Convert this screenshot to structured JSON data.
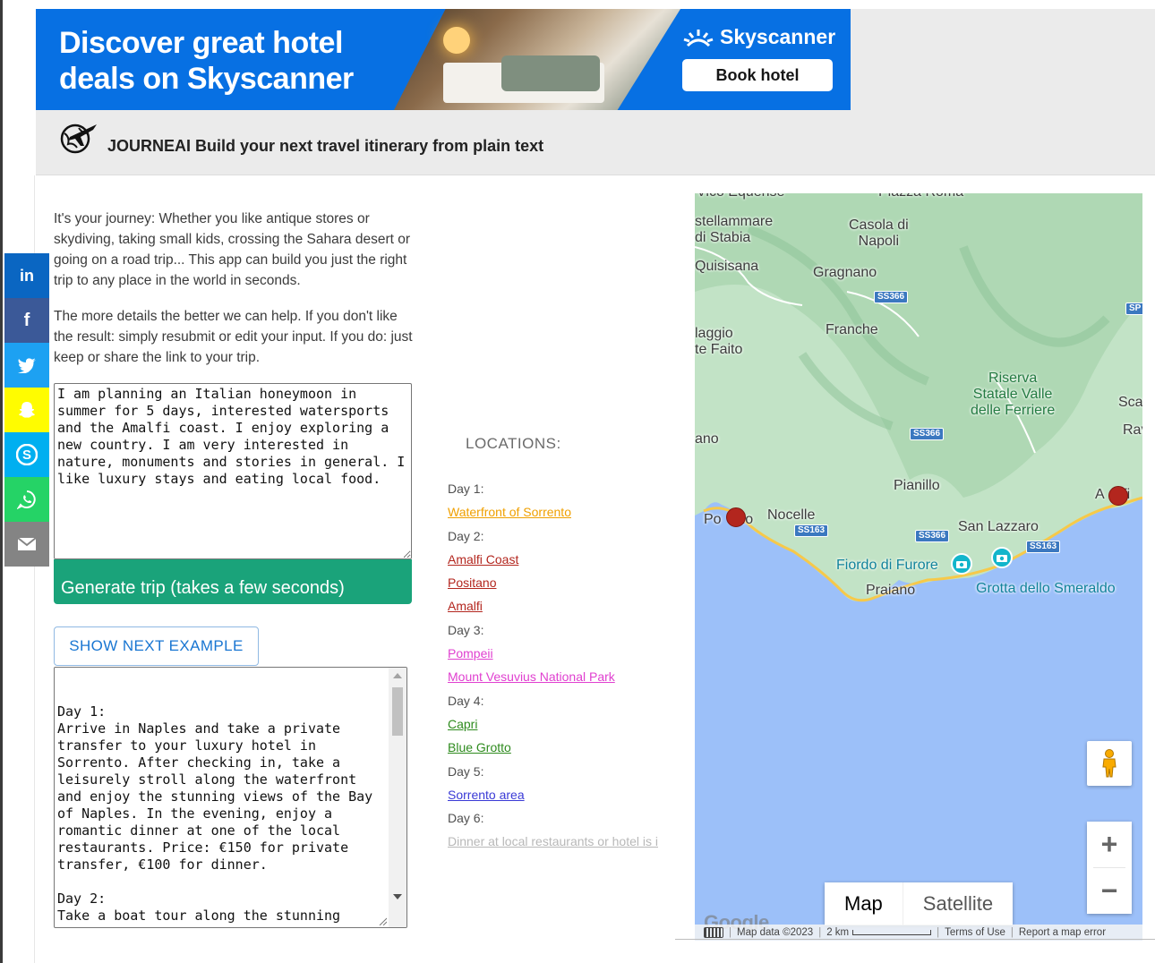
{
  "ad": {
    "headline": "Discover great hotel deals on Skyscanner",
    "brand": "Skyscanner",
    "button_label": "Book hotel",
    "colors": {
      "background": "#0770e3",
      "button": "#ffffff"
    }
  },
  "header": {
    "title": "JOURNEAI Build your next travel itinerary from plain text",
    "logo_icon": "globe-airplane-icon"
  },
  "social": [
    {
      "network": "linkedin",
      "icon": "linkedin-icon",
      "glyph": "in"
    },
    {
      "network": "facebook",
      "icon": "facebook-icon",
      "glyph": "f"
    },
    {
      "network": "twitter",
      "icon": "twitter-icon",
      "glyph": ""
    },
    {
      "network": "snapchat",
      "icon": "snapchat-icon",
      "glyph": ""
    },
    {
      "network": "skype",
      "icon": "skype-icon",
      "glyph": ""
    },
    {
      "network": "whatsapp",
      "icon": "whatsapp-icon",
      "glyph": ""
    },
    {
      "network": "email",
      "icon": "email-icon",
      "glyph": ""
    }
  ],
  "intro": {
    "p1": "It's your journey: Whether you like antique stores or skydiving, taking small kids, crossing the Sahara desert or going on a road trip... This app can build you just the right trip to any place in the world in seconds.",
    "p2": "The more details the better we can help. If you don't like the result: simply resubmit or edit your input. If you do: just keep or share the link to your trip."
  },
  "form": {
    "input_value": "I am planning an Italian honeymoon in summer for 5 days, interested watersports and the Amalfi coast. I enjoy exploring a new country. I am very interested in nature, monuments and stories in general. I like luxury stays and eating local food.",
    "generate_label": "Generate trip (takes a few seconds)",
    "next_example_label": "SHOW NEXT EXAMPLE",
    "colors": {
      "generate": "#1aa37a",
      "next_example": "#1976d2"
    }
  },
  "itinerary": {
    "text": "Day 1:\nArrive in Naples and take a private transfer to your luxury hotel in Sorrento. After checking in, take a leisurely stroll along the waterfront and enjoy the stunning views of the Bay of Naples. In the evening, enjoy a romantic dinner at one of the local restaurants. Price: €150 for private transfer, €100 for dinner.\n\nDay 2:\nTake a boat tour along the stunning"
  },
  "locations": {
    "title": "LOCATIONS:",
    "days": [
      {
        "label": "Day 1:",
        "color": "#f0a000",
        "places": [
          "Waterfront of Sorrento"
        ]
      },
      {
        "label": "Day 2:",
        "color": "#b3261e",
        "places": [
          "Amalfi Coast",
          "Positano",
          "Amalfi"
        ]
      },
      {
        "label": "Day 3:",
        "color": "#e040d0",
        "places": [
          "Pompeii",
          "Mount Vesuvius National Park"
        ]
      },
      {
        "label": "Day 4:",
        "color": "#2e8b1e",
        "places": [
          "Capri",
          "Blue Grotto"
        ]
      },
      {
        "label": "Day 5:",
        "color": "#3a3ad6",
        "places": [
          "Sorrento area"
        ]
      },
      {
        "label": "Day 6:",
        "color": "#b8b8b8",
        "places": [
          "Dinner at local restaurants or hotel is i"
        ]
      }
    ]
  },
  "map": {
    "labels": {
      "vico": "Vico Equense",
      "piazza": "Piazza Roma",
      "castellammare": "stellammare\ndi Stabia",
      "casola": "Casola di\nNapoli",
      "quisisana": "Quisisana",
      "gragnano": "Gragnano",
      "faito": "laggio\nte Faito",
      "franche": "Franche",
      "riserva": "Riserva\nStatale Valle\ndelle Ferriere",
      "sca": "Sca",
      "rav": "Rav",
      "ano": "ano",
      "pianillo": "Pianillo",
      "amalfi": "A    lfi",
      "positano": "Po    no",
      "nocelle": "Nocelle",
      "san_lazzaro": "San Lazzaro",
      "fiordo": "Fiordo di Furore",
      "praiano": "Praiano",
      "grotta": "Grotta dello Smeraldo"
    },
    "roads": [
      "SS366",
      "SS366",
      "SS366",
      "SS163",
      "SS366",
      "SS163",
      "SP"
    ],
    "map_type_active": "Map",
    "map_type_inactive": "Satellite",
    "zoom_in": "+",
    "zoom_out": "−",
    "google": "Google",
    "attribution": "Map data ©2023",
    "scale": "2 km",
    "terms": "Terms of Use",
    "report": "Report a map error",
    "colors": {
      "water": "#9cc0f9",
      "land": "#c4e4c8",
      "pin": "#b3261e",
      "poi": "#12b5cb"
    }
  }
}
